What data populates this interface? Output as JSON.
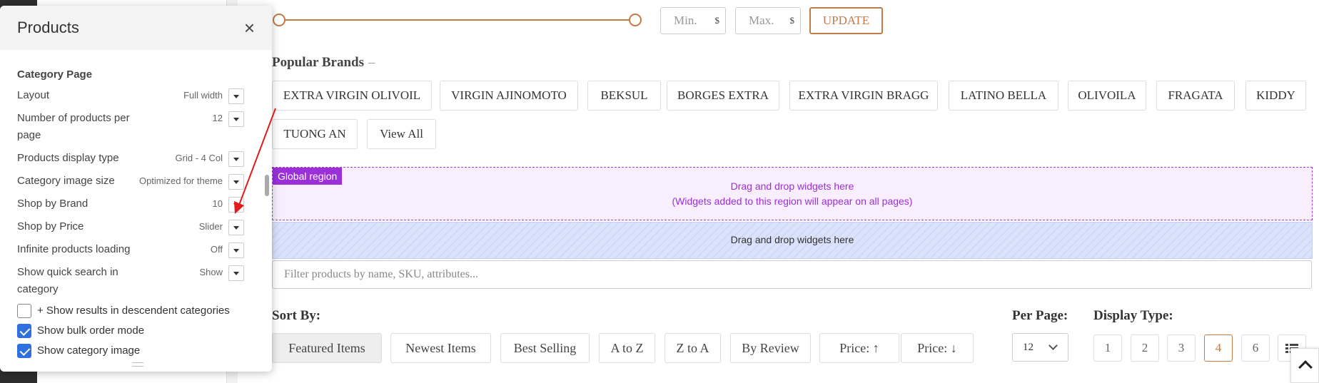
{
  "panel": {
    "title": "Products",
    "section_title": "Category Page",
    "options": [
      {
        "label": "Layout",
        "value": "Full width"
      },
      {
        "label": "Number of products per page",
        "value": "12"
      },
      {
        "label": "Products display type",
        "value": "Grid - 4 Col"
      },
      {
        "label": "Category image size",
        "value": "Optimized for theme"
      },
      {
        "label": "Shop by Brand",
        "value": "10"
      },
      {
        "label": "Shop by Price",
        "value": "Slider"
      },
      {
        "label": "Infinite products loading",
        "value": "Off"
      },
      {
        "label": "Show quick search in category",
        "value": "Show"
      }
    ],
    "checkboxes": [
      {
        "label": "+ Show results in descendent categories",
        "checked": false
      },
      {
        "label": "Show bulk order mode",
        "checked": true
      },
      {
        "label": "Show category image",
        "checked": true
      }
    ]
  },
  "price_filter": {
    "min_placeholder": "Min.",
    "max_placeholder": "Max.",
    "currency": "$",
    "update_label": "UPDATE"
  },
  "brands": {
    "title": "Popular Brands",
    "toggle": "–",
    "items": [
      "EXTRA VIRGIN OLIVOIL",
      "VIRGIN AJINOMOTO",
      "BEKSUL",
      "BORGES EXTRA",
      "EXTRA VIRGIN BRAGG",
      "LATINO BELLA",
      "OLIVOILA",
      "FRAGATA",
      "KIDDY",
      "TUONG AN",
      "View All"
    ]
  },
  "regions": {
    "global_tag": "Global region",
    "global_line1": "Drag and drop widgets here",
    "global_line2": "(Widgets added to this region will appear on all pages)",
    "drop_text": "Drag and drop widgets here"
  },
  "filter_placeholder": "Filter products by name, SKU, attributes...",
  "sort": {
    "label": "Sort By:",
    "options": [
      "Featured Items",
      "Newest Items",
      "Best Selling",
      "A to Z",
      "Z to A",
      "By Review",
      "Price: ↑",
      "Price: ↓"
    ],
    "active": "Featured Items"
  },
  "per_page": {
    "label": "Per Page:",
    "value": "12"
  },
  "display_type": {
    "label": "Display Type:",
    "options": [
      "1",
      "2",
      "3",
      "4",
      "6"
    ],
    "active": "4"
  },
  "colors": {
    "accent": "#c27a47",
    "global_region": "#9b30d9",
    "checkbox": "#2f6fde"
  }
}
